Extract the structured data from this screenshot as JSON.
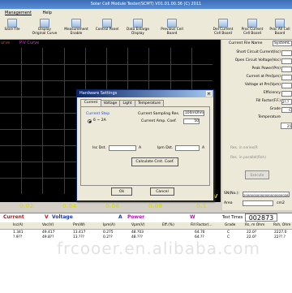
{
  "window": {
    "title": "Solar Cell Module Tester(SCMT) V01.01.00.36 (C) 2011"
  },
  "menu": [
    "Management",
    "Help"
  ],
  "toolbar": [
    {
      "label": "Save File",
      "icon": "save-icon"
    },
    {
      "label": "Display Original Curve",
      "icon": "curve-icon"
    },
    {
      "label": "Measurement Enable",
      "icon": "measure-icon"
    },
    {
      "label": "Control Panel",
      "icon": "control-icon"
    },
    {
      "label": "Data Enlarge Display",
      "icon": "enlarge-icon"
    },
    {
      "label": "Previous Cell Board",
      "icon": "previous-icon"
    },
    {
      "label": "Del Current Cell Board",
      "icon": "delete-icon"
    },
    {
      "label": "Proc Current Cell Board",
      "icon": "process-icon"
    },
    {
      "label": "Proc All Cell Board",
      "icon": "process-all-icon"
    }
  ],
  "chart": {
    "legend": [
      "urve",
      "P-V Curve"
    ],
    "x_ticks": [
      "0.02",
      "0.04",
      "0.06",
      "0.08",
      "0.1"
    ],
    "x_unit": "V",
    "colors": {
      "iv": "#d23c3c",
      "pv": "#d23cd2",
      "axis": "#d8d82a",
      "grid": "#3f3f3f",
      "background": "#000000"
    }
  },
  "panel": {
    "header": [
      "Current File Name",
      "SystemL"
    ],
    "params": [
      "Short Circuit Current(Isc)",
      "Open Circuit Voltage(Voc)",
      "Peak Power(Pm)",
      "Current at Pm(Ipm)",
      "Voltage at Pm(Vpm)",
      "Efficiency",
      "Fill Factor(F.F.)",
      "Grade",
      "Temperature"
    ],
    "values": [
      "",
      "",
      "",
      "",
      "",
      "",
      "2?.?",
      "C",
      ""
    ],
    "temp_value": "25",
    "rs_label": "Res. in series(R",
    "rsh_label": "Res. in parallel(Rsh)",
    "execute": "Execute",
    "sn_label": "SN(No.):",
    "sn_value": "2000000000000000000002874",
    "area_label": "Area",
    "area_unit": "cm2"
  },
  "bottom": {
    "headers": [
      "Current",
      "Voltage",
      "Power"
    ],
    "header_units": [
      "V",
      "A",
      "W"
    ],
    "test_times_label": "Test Times",
    "test_times": "002873",
    "columns": [
      "Isc(A)",
      "Voc(V)",
      "Pm(W)",
      "Ipm(A)",
      "Vpm(V)",
      "Eff.(%)",
      "Fill Factor(...",
      "Grade",
      "Rs, m Ohm",
      "Rsh, Ohm"
    ],
    "rows": [
      [
        "1.341",
        "49.417",
        "13.417",
        "0.275",
        "48.?03",
        "",
        "64.76",
        "C",
        "22.0?",
        "2227.0"
      ],
      [
        "?.9??",
        "49.8??",
        "13.???",
        "0.2??",
        "48.???",
        "",
        "64.??",
        "C",
        "22.0?",
        "22??.?"
      ]
    ],
    "watermark": "frcooer.en.alibaba.com"
  },
  "dialog": {
    "title": "Hardware Settings",
    "tabs": [
      "Current",
      "Voltage",
      "Light",
      "Temperature"
    ],
    "group_label": "Current Step",
    "radio_label": "6 ~ 2A",
    "sampling_label": "Current Sampling Res.",
    "sampling_value": "100mOhm",
    "amp_label": "Current Amp. Coef.",
    "amp_value": "50",
    "isc_label": "Isc Dst.",
    "isc_unit": "A",
    "ipm_label": "Ipm Dst.",
    "ipm_unit": "A",
    "calc_button": "Calculate Crnt. Coef.",
    "ok": "Ok",
    "cancel": "Cancel"
  }
}
